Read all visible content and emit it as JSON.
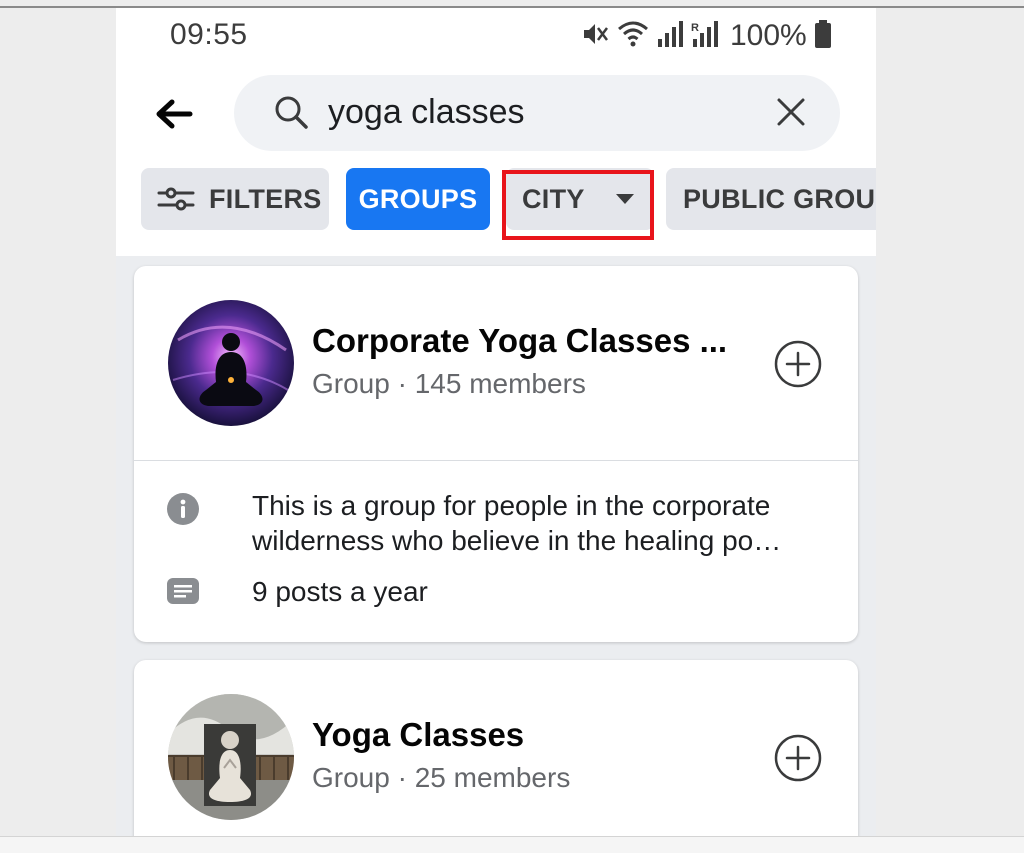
{
  "status_bar": {
    "time": "09:55",
    "battery": "100%"
  },
  "search": {
    "query": "yoga classes"
  },
  "chips": {
    "filters": "FILTERS",
    "groups": "GROUPS",
    "city": "CITY",
    "public_group": "PUBLIC GROUP"
  },
  "colors": {
    "accent": "#1877f2",
    "highlight_box": "#e8141b"
  },
  "results": [
    {
      "name": "Corporate Yoga Classes ...",
      "meta": "Group · 145 members",
      "description": "This is a group for people in the corporate wilderness who believe in the healing po…",
      "activity": "9 posts a year",
      "action_icon": "plus-circle-icon"
    },
    {
      "name": "Yoga Classes",
      "meta": "Group · 25 members",
      "action_icon": "plus-circle-icon"
    }
  ]
}
